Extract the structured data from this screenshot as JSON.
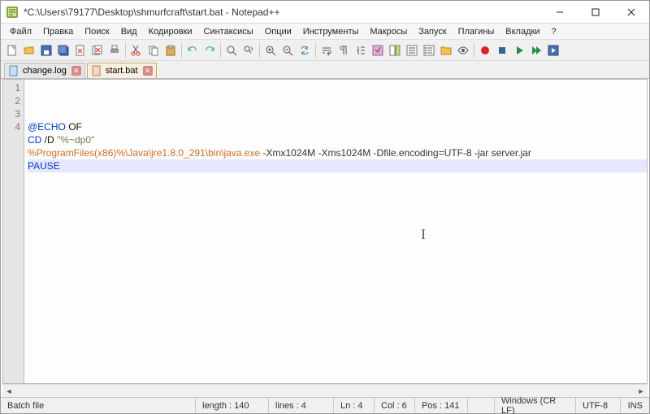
{
  "window": {
    "title": "*C:\\Users\\79177\\Desktop\\shmurfcraft\\start.bat - Notepad++"
  },
  "menu": {
    "items": [
      "Файл",
      "Правка",
      "Поиск",
      "Вид",
      "Кодировки",
      "Синтаксисы",
      "Опции",
      "Инструменты",
      "Макросы",
      "Запуск",
      "Плагины",
      "Вкладки",
      "?"
    ]
  },
  "tabs": [
    {
      "label": "change.log",
      "active": false
    },
    {
      "label": "start.bat",
      "active": true
    }
  ],
  "file": {
    "lines": [
      {
        "segments": [
          {
            "cls": "tok-cmd",
            "t": "@ECHO"
          },
          {
            "cls": "",
            "t": " OF"
          }
        ]
      },
      {
        "segments": [
          {
            "cls": "tok-cmd",
            "t": "CD"
          },
          {
            "cls": "",
            "t": " /D "
          },
          {
            "cls": "tok-str",
            "t": "\"%~dp0\""
          }
        ]
      },
      {
        "segments": [
          {
            "cls": "tok-var",
            "t": "%ProgramFiles(x86)%"
          },
          {
            "cls": "tok-path",
            "t": "\\Java\\jre1.8.0_291\\bin\\java.exe"
          },
          {
            "cls": "tok-opt",
            "t": " -Xmx1024M -Xms1024M -Dfile.encoding=UTF-8 -jar server.jar"
          }
        ]
      },
      {
        "segments": [
          {
            "cls": "tok-cmd",
            "t": "PAUSE"
          }
        ]
      }
    ],
    "line_numbers": [
      "1",
      "2",
      "3",
      "4"
    ]
  },
  "status": {
    "lang": "Batch file",
    "length": "length : 140",
    "lines": "lines : 4",
    "ln": "Ln : 4",
    "col": "Col : 6",
    "pos": "Pos : 141",
    "eol": "Windows (CR LF)",
    "enc": "UTF-8",
    "ins": "INS"
  }
}
